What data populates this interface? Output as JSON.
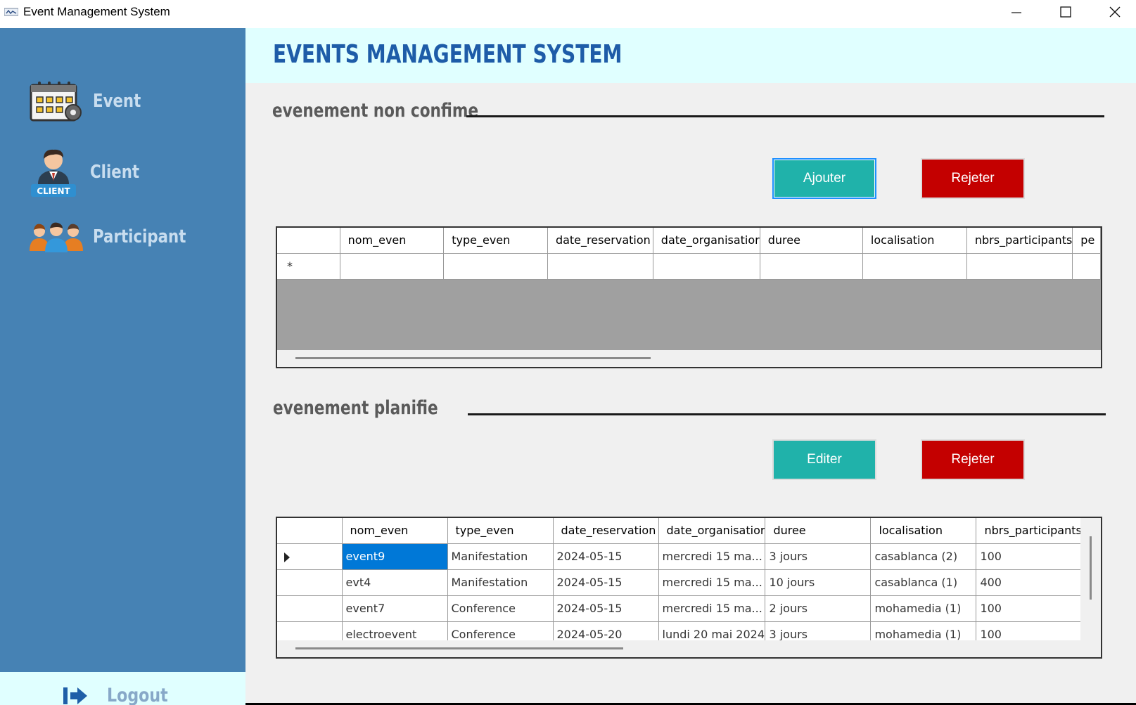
{
  "window": {
    "title": "Event Management System",
    "minimize_glyph": "—",
    "maximize_glyph": "☐",
    "close_glyph": "✕"
  },
  "sidebar": {
    "items": [
      {
        "label": "Event",
        "icon": "calendar-gear-icon"
      },
      {
        "label": "Client",
        "icon": "client-icon",
        "badge": "CLIENT"
      },
      {
        "label": "Participant",
        "icon": "participants-icon"
      }
    ],
    "logout": {
      "label": "Logout",
      "icon": "logout-arrow-icon"
    }
  },
  "header": {
    "title": "EVENTS MANAGEMENT SYSTEM"
  },
  "unconfirmed": {
    "title": "evenement non confime",
    "add_label": "Ajouter",
    "reject_label": "Rejeter",
    "columns": [
      "nom_even",
      "type_even",
      "date_reservation",
      "date_organisatior",
      "duree",
      "localisation",
      "nbrs_participants",
      "pe"
    ],
    "new_row_marker": "*"
  },
  "planned": {
    "title": "evenement planifie",
    "edit_label": "Editer",
    "reject_label": "Rejeter",
    "columns": [
      "nom_even",
      "type_even",
      "date_reservation",
      "date_organisatior",
      "duree",
      "localisation",
      "nbrs_participants"
    ],
    "rows": [
      [
        "event9",
        "Manifestation",
        "2024-05-15",
        "mercredi 15 ma...",
        "3 jours",
        "casablanca (2)",
        "100"
      ],
      [
        "evt4",
        "Manifestation",
        "2024-05-15",
        "mercredi 15 ma...",
        "10 jours",
        "casablanca (1)",
        "400"
      ],
      [
        "event7",
        "Conference",
        "2024-05-15",
        "mercredi 15 ma...",
        "2 jours",
        "mohamedia (1)",
        "100"
      ],
      [
        "electroevent",
        "Conference",
        "2024-05-20",
        "lundi 20 mai 2024",
        "3 jours",
        "mohamedia (1)",
        "100"
      ]
    ]
  },
  "colors": {
    "sidebar": "#4682b4",
    "header": "#e0ffff",
    "title": "#1e5ca8",
    "teal_button": "#20b2aa",
    "red_button": "#c40000",
    "selection": "#0078d7"
  }
}
